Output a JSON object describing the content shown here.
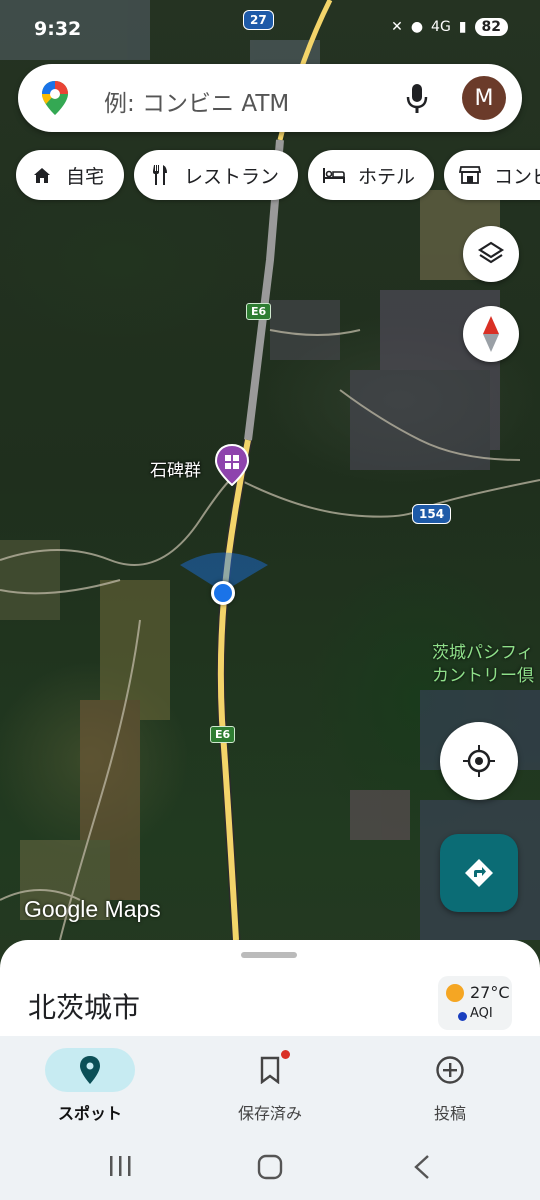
{
  "status_bar": {
    "time": "9:32",
    "network": "4G",
    "battery": "82"
  },
  "search": {
    "placeholder": "例: コンビニ ATM",
    "avatar_initial": "M"
  },
  "chips": [
    {
      "label": "自宅",
      "icon": "home-icon"
    },
    {
      "label": "レストラン",
      "icon": "restaurant-icon"
    },
    {
      "label": "ホテル",
      "icon": "hotel-icon"
    },
    {
      "label": "コンビ",
      "icon": "store-icon"
    }
  ],
  "map": {
    "poi_label": "石碑群",
    "golf_label_line1": "茨城パシフィ",
    "golf_label_line2": "カントリー倶",
    "highway_shield_top": "E6",
    "highway_shield_bottom": "E6",
    "route_number_top": "27",
    "route_number_right": "154",
    "attribution": "Google Maps"
  },
  "sheet": {
    "title": "北茨城市",
    "temperature": "27°C",
    "aqi_label": "AQI"
  },
  "bottom_nav": [
    {
      "label": "スポット",
      "icon": "pin-icon",
      "active": true
    },
    {
      "label": "保存済み",
      "icon": "bookmark-icon",
      "active": false
    },
    {
      "label": "投稿",
      "icon": "add-circle-icon",
      "active": false
    }
  ],
  "colors": {
    "accent": "#0b6c75",
    "nav_active_pill": "#c7ebf2",
    "location_dot": "#1a73e8",
    "poi_marker": "#8e44ad"
  }
}
